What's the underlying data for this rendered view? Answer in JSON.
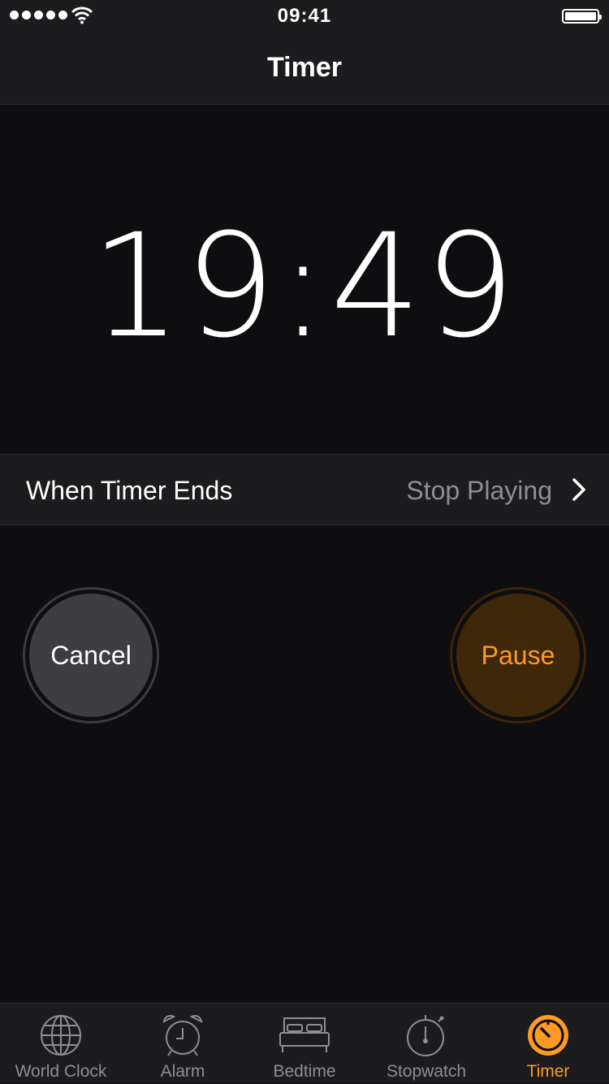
{
  "status_bar": {
    "time": "09:41"
  },
  "nav": {
    "title": "Timer"
  },
  "timer": {
    "remaining": "19:49"
  },
  "when_timer_ends": {
    "label": "When Timer Ends",
    "value": "Stop Playing"
  },
  "buttons": {
    "cancel": "Cancel",
    "pause": "Pause"
  },
  "tabs": [
    {
      "label": "World Clock",
      "icon": "globe-icon",
      "active": false
    },
    {
      "label": "Alarm",
      "icon": "alarm-clock-icon",
      "active": false
    },
    {
      "label": "Bedtime",
      "icon": "bed-icon",
      "active": false
    },
    {
      "label": "Stopwatch",
      "icon": "stopwatch-icon",
      "active": false
    },
    {
      "label": "Timer",
      "icon": "timer-icon",
      "active": true
    }
  ],
  "colors": {
    "accent": "#fd9a23",
    "inactive": "#8e8e93",
    "background": "#0e0d10"
  }
}
